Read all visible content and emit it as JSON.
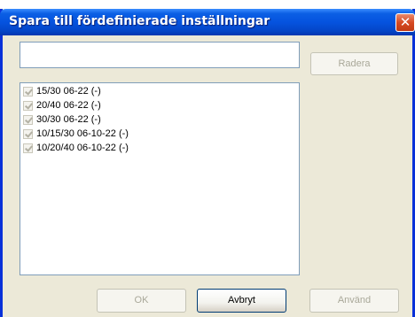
{
  "window": {
    "title": "Spara till fördefinierade inställningar",
    "close_glyph": "✕"
  },
  "name_input": {
    "value": "",
    "placeholder": ""
  },
  "buttons": {
    "delete": "Radera",
    "ok": "OK",
    "cancel": "Avbryt",
    "apply": "Använd"
  },
  "presets": [
    {
      "label": "15/30 06-22 (-)",
      "checked": true,
      "enabled": false
    },
    {
      "label": "20/40 06-22 (-)",
      "checked": true,
      "enabled": false
    },
    {
      "label": "30/30 06-22 (-)",
      "checked": true,
      "enabled": false
    },
    {
      "label": "10/15/30 06-10-22 (-)",
      "checked": true,
      "enabled": false
    },
    {
      "label": "10/20/40 06-10-22 (-)",
      "checked": true,
      "enabled": false
    }
  ],
  "colors": {
    "titlebar": "#0553df",
    "face": "#ece9d8",
    "close": "#d64a22"
  }
}
